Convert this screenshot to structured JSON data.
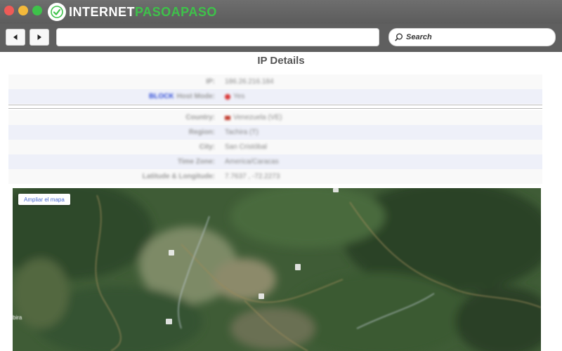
{
  "window": {
    "brand": {
      "prefix": "INTERNET",
      "accent": "PASOAPASO"
    }
  },
  "toolbar": {
    "address_value": "",
    "search_placeholder": "Search",
    "back_icon": "back-arrow-icon",
    "forward_icon": "forward-arrow-icon"
  },
  "page": {
    "title": "IP Details",
    "details": [
      {
        "label": "IP:",
        "value": "186.26.216.184"
      },
      {
        "label_link": "BLOCK",
        "label": "Host Mode:",
        "value": "Yes"
      },
      {
        "label": "Country:",
        "value": "Venezuela (VE)"
      },
      {
        "label": "Region:",
        "value": "Tachira (T)"
      },
      {
        "label": "City:",
        "value": "San Cristóbal"
      },
      {
        "label": "Time Zone:",
        "value": "America/Caracas"
      },
      {
        "label": "Latitude & Longitude:",
        "value": "7.7637 , -72.2273"
      }
    ]
  },
  "map": {
    "enlarge_button": "Ampliar el mapa",
    "edge_label": "bira"
  },
  "colors": {
    "titlebar": "#5c5c5c",
    "close": "#ee5b57",
    "minimize": "#f3b93b",
    "maximize": "#3ec24a",
    "brand_accent": "#3ec24a",
    "row_shade": "#eef0f9",
    "link": "#2b49d6"
  }
}
